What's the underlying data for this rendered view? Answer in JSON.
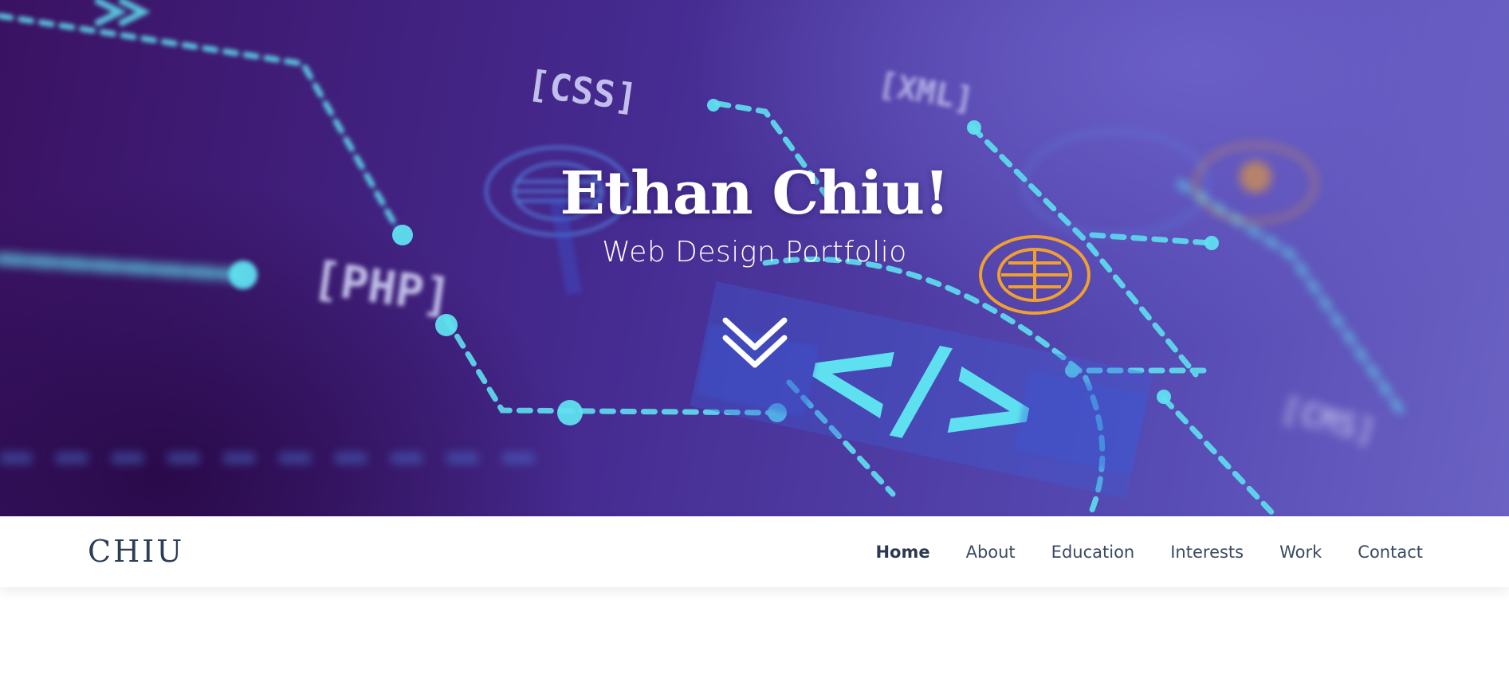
{
  "hero": {
    "title": "Ethan Chiu!",
    "subtitle": "Web Design Portfolio",
    "background_labels": [
      "[CSS]",
      "[XML]",
      "[PHP]",
      "[CMS]",
      "</>"
    ]
  },
  "navbar": {
    "brand": "CHIU",
    "items": [
      {
        "label": "Home",
        "active": true
      },
      {
        "label": "About",
        "active": false
      },
      {
        "label": "Education",
        "active": false
      },
      {
        "label": "Interests",
        "active": false
      },
      {
        "label": "Work",
        "active": false
      },
      {
        "label": "Contact",
        "active": false
      }
    ]
  },
  "colors": {
    "accent_cyan": "#5fe0f0",
    "accent_orange": "#f0a030",
    "nav_text": "#3a4a62",
    "hero_base": "#452a8f"
  },
  "icons": {
    "scroll": "double-chevron-down-icon"
  }
}
